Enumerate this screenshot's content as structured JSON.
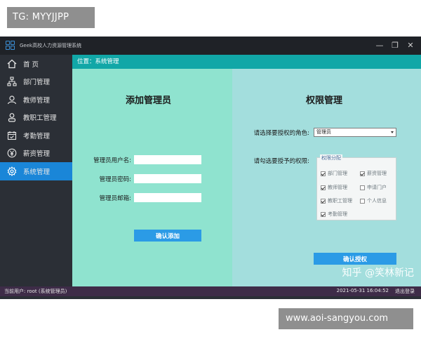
{
  "badges": {
    "tg": "TG: MYYJJPP",
    "site": "www.aoi-sangyou.com"
  },
  "window": {
    "title": "Geek高校人力资源管理系统",
    "controls": {
      "minimize": "—",
      "restore": "❐",
      "close": "✕"
    }
  },
  "sidebar": {
    "items": [
      {
        "label": "首 页",
        "icon": "home-icon",
        "active": false
      },
      {
        "label": "部门管理",
        "icon": "org-chart-icon",
        "active": false
      },
      {
        "label": "教师管理",
        "icon": "teacher-icon",
        "active": false
      },
      {
        "label": "教职工管理",
        "icon": "staff-icon",
        "active": false
      },
      {
        "label": "考勤管理",
        "icon": "calendar-icon",
        "active": false
      },
      {
        "label": "薪资管理",
        "icon": "yen-icon",
        "active": false
      },
      {
        "label": "系统管理",
        "icon": "gear-icon",
        "active": true
      }
    ]
  },
  "location": {
    "text": "位置：系统管理"
  },
  "add_admin": {
    "title": "添加管理员",
    "username_label": "管理员用户名:",
    "username_value": "",
    "password_label": "管理员密码:",
    "password_value": "",
    "email_label": "管理员邮箱:",
    "email_value": "",
    "confirm_label": "确认添加"
  },
  "permissions": {
    "title": "权限管理",
    "role_label": "请选择要授权的角色:",
    "role_selected": "管理员",
    "perm_label": "请勾选要授予的权限:",
    "group_legend": "权限分配",
    "items": [
      {
        "label": "部门管理",
        "checked": true
      },
      {
        "label": "薪资管理",
        "checked": true
      },
      {
        "label": "教师管理",
        "checked": true
      },
      {
        "label": "申请门户",
        "checked": false
      },
      {
        "label": "教职工管理",
        "checked": true
      },
      {
        "label": "个人信息",
        "checked": false
      },
      {
        "label": "考勤管理",
        "checked": true
      }
    ],
    "confirm_label": "确认授权"
  },
  "statusbar": {
    "user": "当前用户:  root (系统管理员)",
    "time": "2021-05-31 16:04:52",
    "logout": "退出登录"
  },
  "watermark": "知乎 @笑林新记"
}
